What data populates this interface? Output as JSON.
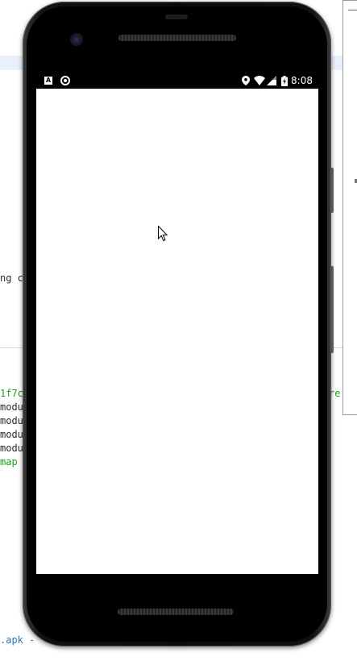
{
  "ide": {
    "editor_fragment": "ng c",
    "log_lines": [
      {
        "text": "1f7c",
        "color": "green"
      },
      {
        "text": "modu",
        "color": "default"
      },
      {
        "text": "modu",
        "color": "default"
      },
      {
        "text": "modu",
        "color": "default"
      },
      {
        "text": "modu",
        "color": "default"
      },
      {
        "text": "map",
        "color": "green"
      }
    ],
    "right_log_fragment": "re",
    "bottom_fragment": ".apk -"
  },
  "emulator": {
    "status_bar": {
      "notification_icons": [
        "a-icon",
        "circle-icon"
      ],
      "system_icons": [
        "location-icon",
        "wifi-icon",
        "signal-icon",
        "battery-charging-icon"
      ],
      "time": "8:08"
    },
    "screen": {
      "background": "#ffffff"
    }
  },
  "colors": {
    "log_green": "#17a317",
    "link_blue": "#2a76b9",
    "selection_band": "#e8f0fb"
  }
}
